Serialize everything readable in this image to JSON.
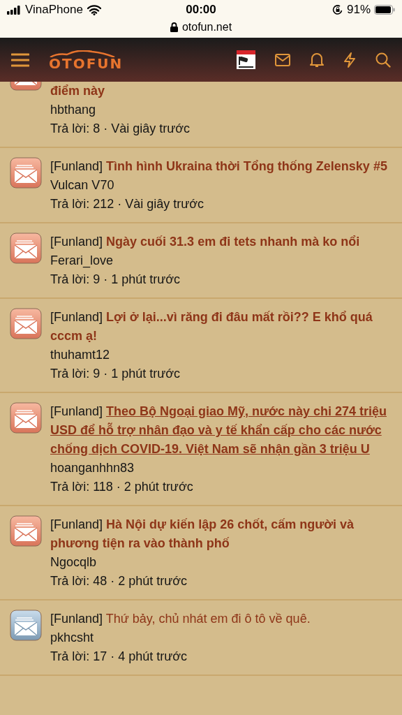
{
  "status_bar": {
    "carrier": "VinaPhone",
    "time": "00:00",
    "battery": "91%"
  },
  "address_bar": {
    "url": "otofun.net"
  },
  "header": {
    "logo": "OTOFUN"
  },
  "threads": [
    {
      "kind": "partial",
      "title": "điểm này",
      "author": "hbthang",
      "meta": "Trả lời: 8 · Vài giây trước",
      "unread": true,
      "selected": false
    },
    {
      "kind": "full",
      "prefix": "[Funland]",
      "title": "Tình hình Ukraina thời Tổng thống Zelensky #5",
      "author": "Vulcan V70",
      "meta": "Trả lời: 212 · Vài giây trước",
      "unread": true,
      "selected": false
    },
    {
      "kind": "full",
      "prefix": "[Funland]",
      "title": "Ngày cuối 31.3 em đi tets nhanh mà ko nổi",
      "author": "Ferari_love",
      "meta": "Trả lời: 9 · 1 phút trước",
      "unread": true,
      "selected": false
    },
    {
      "kind": "full",
      "prefix": "[Funland]",
      "title": "Lợi ở lại...vì răng đi đâu mất rồi?? E khổ quá cccm ạ!",
      "author": "thuhamt12",
      "meta": "Trả lời: 9 · 1 phút trước",
      "unread": true,
      "selected": false
    },
    {
      "kind": "full",
      "prefix": "[Funland]",
      "title": "Theo Bộ Ngoại giao Mỹ, nước này chi 274 triệu USD để hỗ trợ nhân đạo và y tế khẩn cấp cho các nước chống dịch COVID-19. Việt Nam sẽ nhận gần 3 triệu U",
      "author": "hoanganhhn83",
      "meta": "Trả lời: 118 · 2 phút trước",
      "unread": true,
      "selected": true
    },
    {
      "kind": "full",
      "prefix": "[Funland]",
      "title": "Hà Nội dự kiến lập 26 chốt, cấm người và phương tiện ra vào thành phố",
      "author": "Ngocqlb",
      "meta": "Trả lời: 48 · 2 phút trước",
      "unread": true,
      "selected": false
    },
    {
      "kind": "full",
      "prefix": "[Funland]",
      "title": "Thứ bảy, chủ nhát em đi ô tô về quê.",
      "author": "pkhcsht",
      "meta": "Trả lời: 17 · 4 phút trước",
      "unread": false,
      "selected": false
    }
  ]
}
